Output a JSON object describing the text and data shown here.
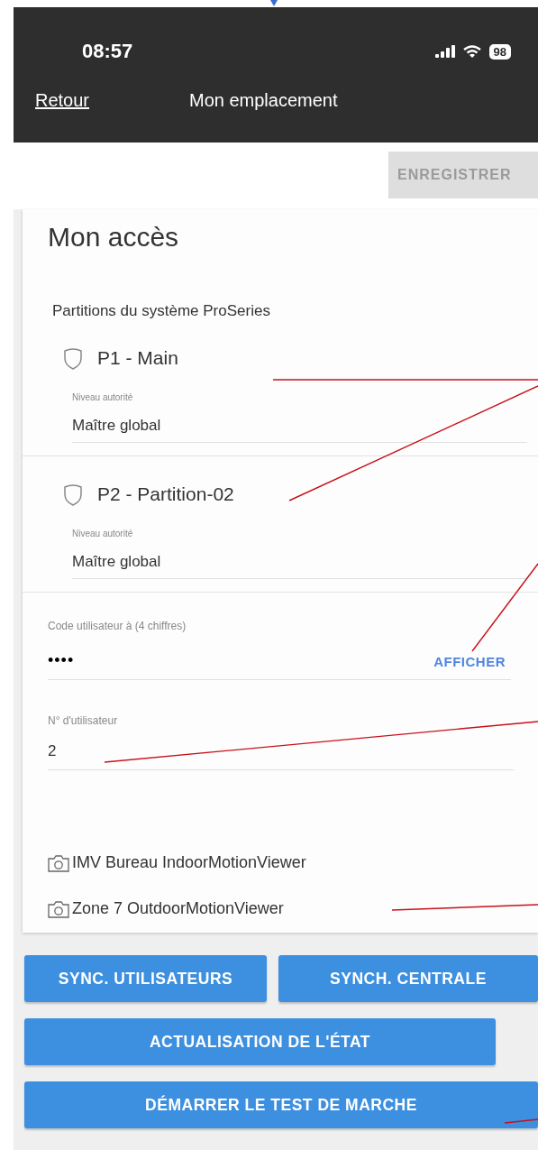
{
  "status_bar": {
    "time": "08:57",
    "battery": "98"
  },
  "nav": {
    "back": "Retour",
    "title": "Mon emplacement"
  },
  "save_button": {
    "label": "ENREGISTRER",
    "disabled": true
  },
  "card": {
    "title": "Mon accès",
    "section_label": "Partitions du système ProSeries",
    "partitions": [
      {
        "name": "P1 - Main",
        "field_label": "Niveau autorité",
        "value": "Maître global"
      },
      {
        "name": "P2 - Partition-02",
        "field_label": "Niveau autorité",
        "value": "Maître global"
      }
    ],
    "code_field": {
      "label": "Code utilisateur à (4 chiffres)",
      "value": "••••",
      "toggle": "AFFICHER"
    },
    "user_number_field": {
      "label": "N° d'utilisateur",
      "value": "2"
    },
    "cameras": [
      {
        "name": "IMV Bureau IndoorMotionViewer"
      },
      {
        "name": "Zone 7 OutdoorMotionViewer"
      }
    ]
  },
  "button_rows": [
    [
      {
        "label": "SYNC. UTILISATEURS"
      },
      {
        "label": "SYNCH. CENTRALE"
      }
    ],
    [
      {
        "label": "ACTUALISATION DE L'ÉTAT"
      }
    ],
    [
      {
        "label": "DÉMARRER LE TEST DE MARCHE"
      }
    ]
  ]
}
